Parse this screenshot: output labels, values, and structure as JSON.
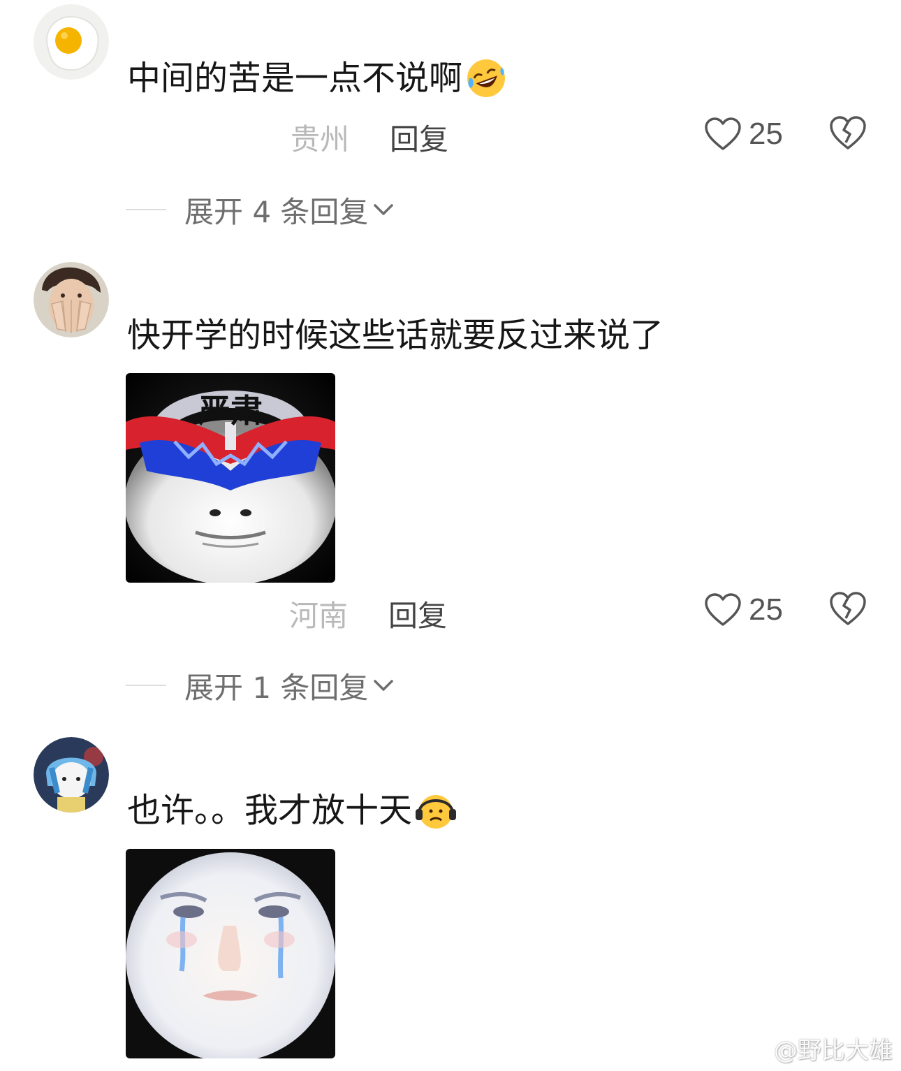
{
  "comments": [
    {
      "text": "中间的苦是一点不说啊",
      "emoji": "rofl-emoji",
      "location": "贵州",
      "reply_label": "回复",
      "likes": "25",
      "expand_label": "展开 4 条回复"
    },
    {
      "text": "快开学的时候这些话就要反过来说了",
      "sticker_caption": "严肃",
      "location": "河南",
      "reply_label": "回复",
      "likes": "25",
      "expand_label": "展开 1 条回复"
    },
    {
      "text": "也许。。我才放十天",
      "emoji": "headphones-sad-emoji"
    }
  ],
  "watermark": "@野比大雄",
  "icons": {
    "like": "heart-outline-icon",
    "dislike": "broken-heart-icon",
    "expand": "chevron-down-icon",
    "watermark": "weibo-icon"
  },
  "colors": {
    "text": "#161616",
    "location": "#b9b9b9",
    "reply": "#444444",
    "expand": "#6e6e6e",
    "divider": "#dddddd"
  }
}
